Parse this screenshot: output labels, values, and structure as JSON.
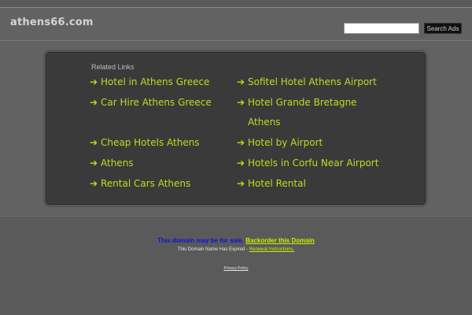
{
  "header": {
    "site_title": "athens66.com",
    "search_placeholder": "",
    "search_button": "Search Ads"
  },
  "related": {
    "title": "Related Links",
    "left": [
      {
        "label": "Hotel in Athens Greece"
      },
      {
        "label": "Car Hire Athens Greece"
      },
      {
        "label": "Cheap Hotels Athens"
      },
      {
        "label": "Athens"
      },
      {
        "label": "Rental Cars Athens"
      }
    ],
    "right": [
      {
        "label": "Sofitel Hotel Athens Airport"
      },
      {
        "label": "Hotel Grande Bretagne Athens"
      },
      {
        "label": "Hotel by Airport"
      },
      {
        "label": "Hotels in Corfu Near Airport"
      },
      {
        "label": "Hotel Rental"
      }
    ],
    "arrow_glyph": "➔"
  },
  "footer": {
    "for_sale_text": "This domain may be for sale.",
    "backorder_link": "Backorder this Domain",
    "expired_text": "This Domain Name Has Expired -",
    "renewal_link": "Renewal Instructions.",
    "privacy_link": "Privacy Policy"
  },
  "colors": {
    "link_green": "#b6e01e",
    "panel_bg": "#3a3a3a",
    "page_bg": "#5a5a5a",
    "for_sale_blue": "#1010e0"
  }
}
